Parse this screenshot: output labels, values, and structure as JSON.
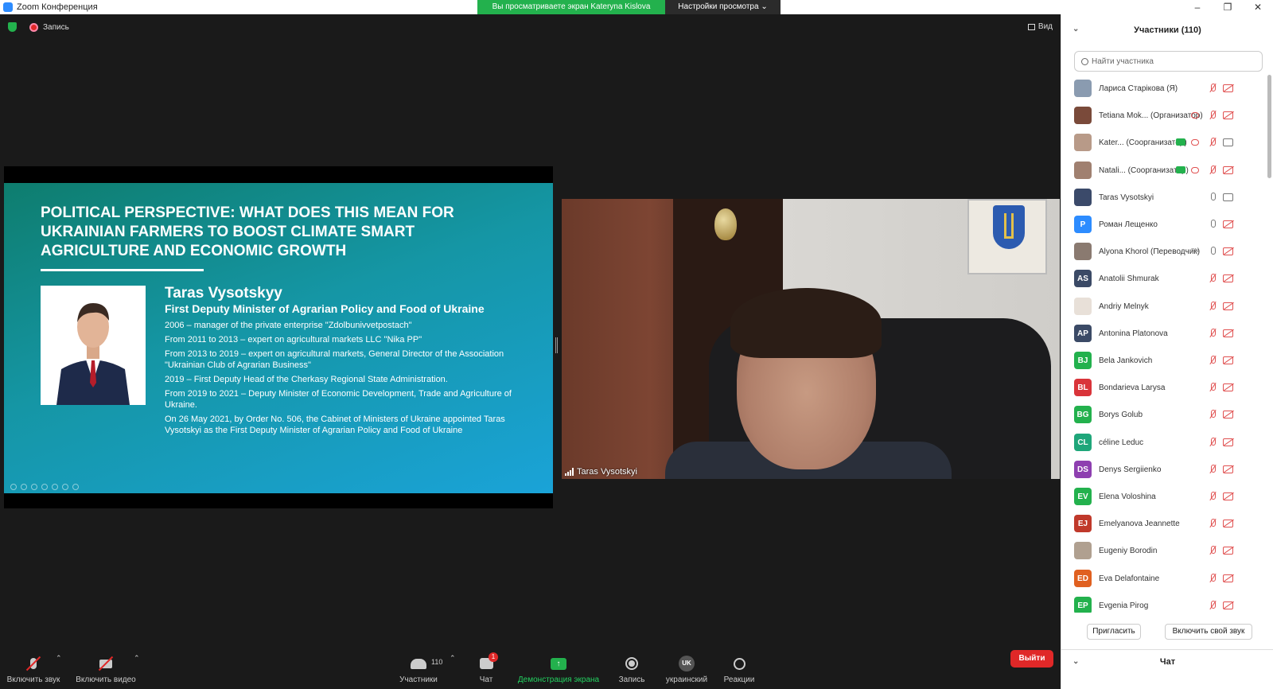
{
  "window": {
    "title": "Zoom Конференция",
    "share_banner": "Вы просматриваете экран Kateryna Kislova",
    "view_settings": "Настройки просмотра ⌄",
    "minimize": "–",
    "restore": "❐",
    "close": "✕"
  },
  "meeting": {
    "recording_label": "Запись",
    "view_label": "Вид"
  },
  "slide": {
    "title": "POLITICAL PERSPECTIVE: WHAT DOES THIS MEAN FOR UKRAINIAN FARMERS TO BOOST CLIMATE SMART AGRICULTURE AND ECONOMIC GROWTH",
    "name": "Taras Vysotskyy",
    "position": "First Deputy Minister of Agrarian Policy and Food of Ukraine",
    "bio": [
      "2006 – manager of the private enterprise \"Zdolbunivvetpostach\"",
      "From 2011 to 2013 – expert on agricultural markets LLC \"Nika PP\"",
      "From 2013 to 2019 – expert on agricultural markets, General Director of the Association \"Ukrainian Club of Agrarian Business\"",
      "2019 – First Deputy Head of the Cherkasy Regional State Administration.",
      "From 2019 to 2021 – Deputy Minister of Economic Development, Trade and Agriculture of Ukraine.",
      "On 26 May 2021, by Order No. 506, the Cabinet of Ministers of Ukraine appointed Taras Vysotskyi as the First Deputy Minister of Agrarian Policy and Food of Ukraine"
    ]
  },
  "camera": {
    "participant_name": "Taras Vysotskyi"
  },
  "toolbar": {
    "unmute": "Включить звук",
    "start_video": "Включить видео",
    "participants": "Участники",
    "participants_count": "110",
    "chat": "Чат",
    "chat_badge": "1",
    "share_screen": "Демонстрация экрана",
    "record": "Запись",
    "language": "украинский",
    "language_code": "UK",
    "reactions": "Реакции",
    "leave": "Выйти",
    "caret": "⌃"
  },
  "panel": {
    "title": "Участники (110)",
    "search_placeholder": "Найти участника",
    "invite": "Пригласить",
    "unmute_me": "Включить свой звук",
    "chat_title": "Чат",
    "chevron": "⌄",
    "participants": [
      {
        "name": "Лариса Старікова (Я)",
        "initials": "",
        "color": "#8a9bb0",
        "mic": "muted",
        "video": "off"
      },
      {
        "name": "Tetiana Mok... (Организатор)",
        "initials": "",
        "color": "#7a4a3a",
        "mic": "muted",
        "video": "off",
        "cloud": true
      },
      {
        "name": "Kater... (Соорганизатор)",
        "initials": "",
        "color": "#b89a88",
        "mic": "muted",
        "video": "on",
        "cloud": true,
        "share": true
      },
      {
        "name": "Natali... (Соорганизатор)",
        "initials": "",
        "color": "#a08070",
        "mic": "muted",
        "video": "off",
        "cloud": true,
        "share": true
      },
      {
        "name": "Taras Vysotskyi",
        "initials": "",
        "color": "#3b4a6a",
        "mic": "on",
        "video": "on"
      },
      {
        "name": "Роман Лещенко",
        "initials": "P",
        "color": "#2d8cff",
        "mic": "on",
        "video": "off"
      },
      {
        "name": "Alyona Khorol (Переводчик)",
        "initials": "",
        "color": "#8a7a70",
        "mic": "on",
        "video": "off",
        "lang": "EN"
      },
      {
        "name": "Anatolii Shmurak",
        "initials": "AS",
        "color": "#3b4a66",
        "mic": "muted",
        "video": "off"
      },
      {
        "name": "Andriy Melnyk",
        "initials": "",
        "color": "#e8e0d8",
        "mic": "muted",
        "video": "off"
      },
      {
        "name": "Antonina Platonova",
        "initials": "AP",
        "color": "#3b4a66",
        "mic": "muted",
        "video": "off"
      },
      {
        "name": "Bela Jankovich",
        "initials": "BJ",
        "color": "#23b14d",
        "mic": "muted",
        "video": "off"
      },
      {
        "name": "Bondarieva Larysa",
        "initials": "BL",
        "color": "#d9343a",
        "mic": "muted",
        "video": "off"
      },
      {
        "name": "Borys Golub",
        "initials": "BG",
        "color": "#23b14d",
        "mic": "muted",
        "video": "off"
      },
      {
        "name": "céline Leduc",
        "initials": "CL",
        "color": "#1fa67a",
        "mic": "muted",
        "video": "off"
      },
      {
        "name": "Denys Sergiienko",
        "initials": "DS",
        "color": "#8e3fb0",
        "mic": "muted",
        "video": "off"
      },
      {
        "name": "Elena Voloshina",
        "initials": "EV",
        "color": "#23b14d",
        "mic": "muted",
        "video": "off"
      },
      {
        "name": "Emelyanova Jeannette",
        "initials": "EJ",
        "color": "#c0392b",
        "mic": "muted",
        "video": "off"
      },
      {
        "name": "Eugeniy Borodin",
        "initials": "",
        "color": "#b0a090",
        "mic": "muted",
        "video": "off"
      },
      {
        "name": "Eva Delafontaine",
        "initials": "ED",
        "color": "#e06020",
        "mic": "muted",
        "video": "off"
      },
      {
        "name": "Evgenia Pirog",
        "initials": "EP",
        "color": "#23b14d",
        "mic": "muted",
        "video": "off"
      }
    ]
  }
}
